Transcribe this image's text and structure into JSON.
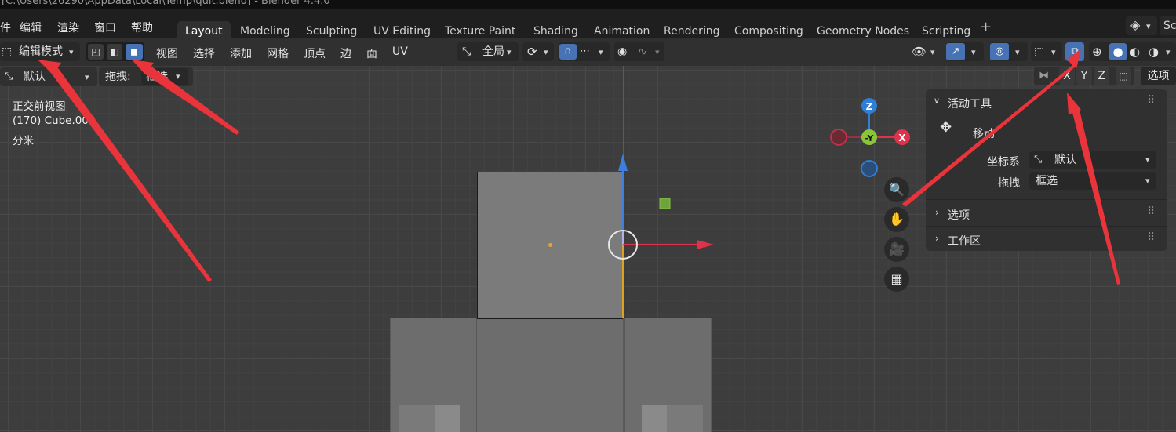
{
  "window": {
    "title": "[C:\\Users\\26290\\AppData\\Local\\Temp\\quit.blend] - Blender 4.4.0"
  },
  "menubar": {
    "items": [
      "件",
      "编辑",
      "渲染",
      "窗口",
      "帮助"
    ],
    "workspace_tabs": [
      "Layout",
      "Modeling",
      "Sculpting",
      "UV Editing",
      "Texture Paint",
      "Shading",
      "Animation",
      "Rendering",
      "Compositing",
      "Geometry Nodes",
      "Scripting"
    ],
    "active_tab": "Layout",
    "add_tab": "+",
    "scene_label": "Sc"
  },
  "header": {
    "mode": "编辑模式",
    "menus": [
      "视图",
      "选择",
      "添加",
      "网格",
      "顶点",
      "边",
      "面",
      "UV"
    ],
    "transform_orientation": "全局",
    "select_mode_active": "face"
  },
  "tool_settings": {
    "orientation": "默认",
    "drag_label": "拖拽:",
    "drag_value": "框选",
    "axes": [
      "X",
      "Y",
      "Z"
    ],
    "options": "选项"
  },
  "viewport": {
    "view_name": "正交前视图",
    "object_info": "(170) Cube.002",
    "unit": "分米",
    "gizmo": {
      "z": "Z",
      "y": "-Y",
      "x": "X"
    }
  },
  "side_panel": {
    "active_tool": "活动工具",
    "tool_name": "移动",
    "coord_label": "坐标系",
    "coord_value": "默认",
    "drag_label": "拖拽",
    "drag_value": "框选",
    "options": "选项",
    "workspace": "工作区"
  },
  "colors": {
    "accent": "#4772b3",
    "arrow": "#e8343a",
    "x_axis": "#e0324b",
    "y_axis": "#8bc43a",
    "z_axis": "#2f7ed8"
  }
}
